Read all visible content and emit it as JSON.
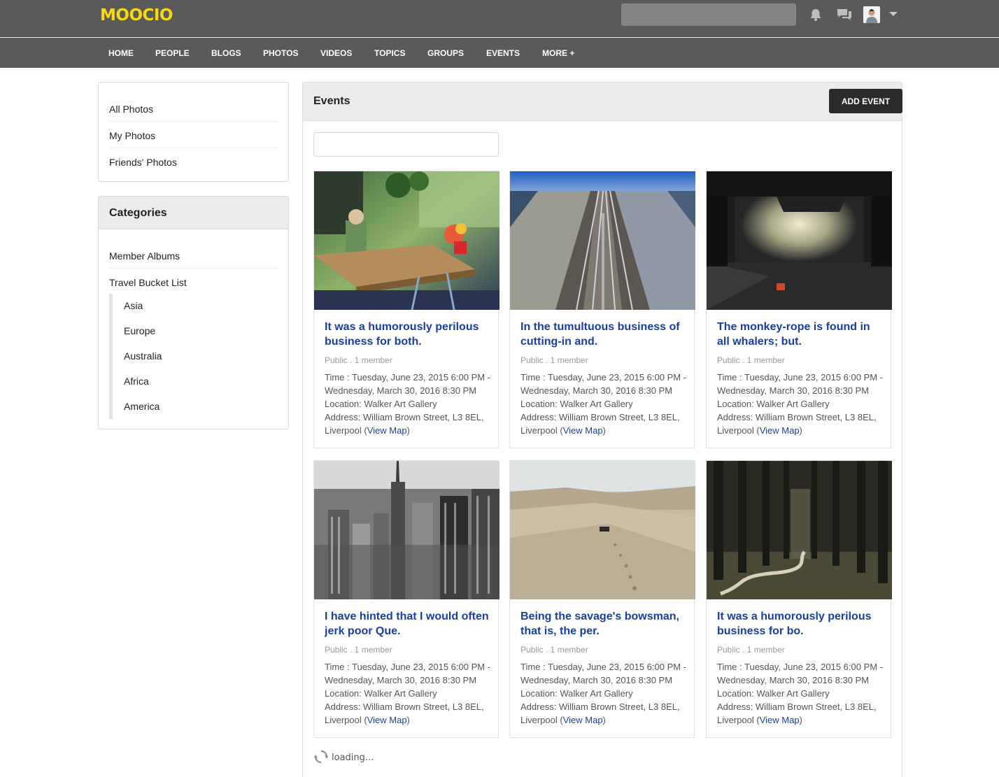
{
  "app": {
    "logo": "MOOCIO"
  },
  "header": {
    "search_placeholder": "",
    "icons": [
      "bell-icon",
      "chat-icon",
      "avatar",
      "chevron-down-icon"
    ]
  },
  "nav": [
    "HOME",
    "PEOPLE",
    "BLOGS",
    "PHOTOS",
    "VIDEOS",
    "TOPICS",
    "GROUPS",
    "EVENTS",
    "MORE +"
  ],
  "sidebar": {
    "links": [
      "All Photos",
      "My Photos",
      "Friends' Photos"
    ],
    "categories_title": "Categories",
    "categories": [
      "Member Albums",
      "Travel Bucket List"
    ],
    "subcategories": [
      "Asia",
      "Europe",
      "Australia",
      "Africa",
      "America"
    ]
  },
  "main": {
    "title": "Events",
    "add_button": "ADD EVENT",
    "filter_placeholder": "",
    "cards": [
      {
        "title": "It was a humorously perilous business for both.",
        "meta": "Public . 1 member",
        "time": "Time : Tuesday, June 23, 2015 6:00 PM - Wednesday, March 30, 2016 8:30 PM",
        "location": "Location: Walker Art Gallery",
        "address": "Address: William Brown Street, L3 8EL, Liverpool (",
        "map_link": "View Map",
        "address_end": ")"
      },
      {
        "title": "In the tumultuous business of cutting-in and.",
        "meta": "Public . 1 member",
        "time": "Time : Tuesday, June 23, 2015 6:00 PM - Wednesday, March 30, 2016 8:30 PM",
        "location": "Location: Walker Art Gallery",
        "address": "Address: William Brown Street, L3 8EL, Liverpool (",
        "map_link": "View Map",
        "address_end": ")"
      },
      {
        "title": "The monkey-rope is found in all whalers; but.",
        "meta": "Public . 1 member",
        "time": "Time : Tuesday, June 23, 2015 6:00 PM - Wednesday, March 30, 2016 8:30 PM",
        "location": "Location: Walker Art Gallery",
        "address": "Address: William Brown Street, L3 8EL, Liverpool (",
        "map_link": "View Map",
        "address_end": ")"
      },
      {
        "title": "I have hinted that I would often jerk poor Que.",
        "meta": "Public . 1 member",
        "time": "Time : Tuesday, June 23, 2015 6:00 PM - Wednesday, March 30, 2016 8:30 PM",
        "location": "Location: Walker Art Gallery",
        "address": "Address: William Brown Street, L3 8EL, Liverpool (",
        "map_link": "View Map",
        "address_end": ")"
      },
      {
        "title": "Being the savage's bowsman, that is, the per.",
        "meta": "Public . 1 member",
        "time": "Time : Tuesday, June 23, 2015 6:00 PM - Wednesday, March 30, 2016 8:30 PM",
        "location": "Location: Walker Art Gallery",
        "address": "Address: William Brown Street, L3 8EL, Liverpool (",
        "map_link": "View Map",
        "address_end": ")"
      },
      {
        "title": "It was a humorously perilous business for bo.",
        "meta": "Public . 1 member",
        "time": "Time : Tuesday, June 23, 2015 6:00 PM - Wednesday, March 30, 2016 8:30 PM",
        "location": "Location: Walker Art Gallery",
        "address": "Address: William Brown Street, L3 8EL, Liverpool (",
        "map_link": "View Map",
        "address_end": ")"
      }
    ],
    "loading_text": "loading..."
  },
  "colors": {
    "topbar": "#5a5a5a",
    "logo": "#f5d90c",
    "link": "#1a3fa0",
    "button": "#2b2b2b"
  }
}
